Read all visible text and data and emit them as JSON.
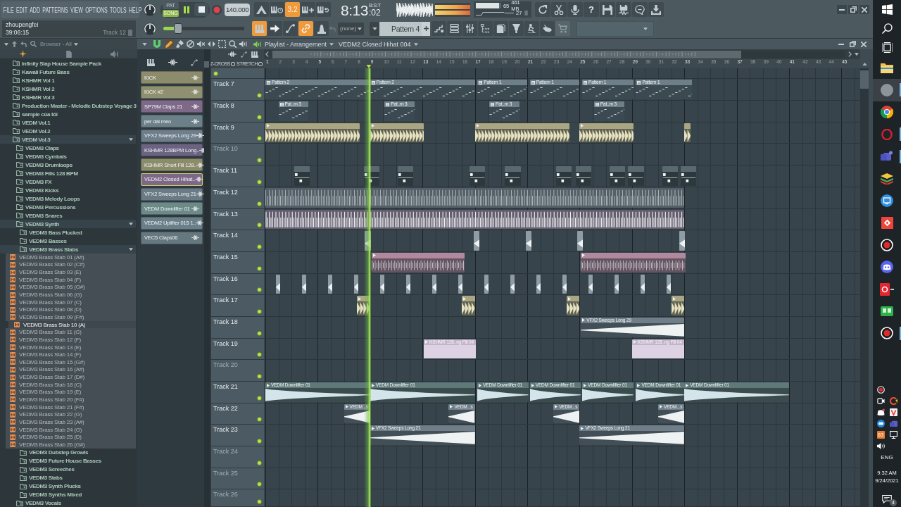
{
  "menu": [
    "FILE",
    "EDIT",
    "ADD",
    "PATTERNS",
    "VIEW",
    "OPTIONS",
    "TOOLS",
    "HELP"
  ],
  "transport": {
    "modes": [
      {
        "label": "PAT",
        "selected": false
      },
      {
        "label": "SONG",
        "selected": true
      }
    ],
    "playing": true,
    "tempo": "140.000"
  },
  "record_options": [
    {
      "on": false
    },
    {
      "on": false
    },
    {
      "label": "3.2",
      "on": true
    },
    {
      "on": false
    },
    {
      "on": false
    }
  ],
  "clock": {
    "time": "8:13",
    "ticks": ":02",
    "unit": "B:S:T"
  },
  "cpu": {
    "level": 0.93,
    "reading": "65",
    "memory": "461 MB",
    "polyphony": "27"
  },
  "help": "?",
  "hint": {
    "user": "zhoupengfei",
    "time": "39:06:15",
    "target": "Track 12"
  },
  "master": {
    "level": 0.18
  },
  "snap_tools": [
    {
      "on": true
    },
    {
      "on": false
    },
    {
      "on": false
    },
    {
      "on": true
    },
    {
      "on": false
    }
  ],
  "mixer_target": "(none)",
  "pattern": "Pattern 4",
  "browser": {
    "title": "Browser - All",
    "items": [
      {
        "kind": "folder",
        "name": "Infinity Slap House Sample Pack",
        "expanded": false
      },
      {
        "kind": "folder",
        "name": "Kawaii Future Bass",
        "expanded": false
      },
      {
        "kind": "folder",
        "name": "KSHMR Vol 1",
        "expanded": false
      },
      {
        "kind": "folder",
        "name": "KSHMR Vol 2",
        "expanded": false
      },
      {
        "kind": "folder",
        "name": "KSHMR Vol 3",
        "expanded": false
      },
      {
        "kind": "folder",
        "name": "Production Master - Melodic Dubstep Voyage 3",
        "expanded": false
      },
      {
        "kind": "folder",
        "name": "sample của tôi",
        "expanded": false
      },
      {
        "kind": "folder",
        "name": "VEDM Vol.1",
        "expanded": false
      },
      {
        "kind": "folder",
        "name": "VEDM Vol.2",
        "expanded": false
      },
      {
        "kind": "folder",
        "name": "VEDM Vol.3",
        "expanded": true,
        "children": [
          {
            "kind": "folder",
            "name": "VEDM3 Claps",
            "expanded": false
          },
          {
            "kind": "folder",
            "name": "VEDM3 Cymbals",
            "expanded": false
          },
          {
            "kind": "folder",
            "name": "VEDM3 Drumloops",
            "expanded": false
          },
          {
            "kind": "folder",
            "name": "VEDM3 Fills 128 BPM",
            "expanded": false
          },
          {
            "kind": "folder",
            "name": "VEDM3 FX",
            "expanded": false
          },
          {
            "kind": "folder",
            "name": "VEDM3 Kicks",
            "expanded": false
          },
          {
            "kind": "folder",
            "name": "VEDM3 Melody Loops",
            "expanded": false
          },
          {
            "kind": "folder",
            "name": "VEDM3 Percussions",
            "expanded": false
          },
          {
            "kind": "folder",
            "name": "VEDM3 Snares",
            "expanded": false
          },
          {
            "kind": "folder",
            "name": "VEDM3 Synth",
            "expanded": true,
            "children": [
              {
                "kind": "folder",
                "name": "VEDM3 Bass Plucked",
                "expanded": false
              },
              {
                "kind": "folder",
                "name": "VEDM3 Basses",
                "expanded": false
              },
              {
                "kind": "folder",
                "name": "VEDM3 Brass Stabs",
                "expanded": true,
                "children": [
                  {
                    "kind": "file",
                    "name": "VEDM3 Brass Stab 01 (A#)",
                    "selected": false
                  },
                  {
                    "kind": "file",
                    "name": "VEDM3 Brass Stab 02 (C#)",
                    "selected": false
                  },
                  {
                    "kind": "file",
                    "name": "VEDM3 Brass Stab 03 (E)",
                    "selected": false
                  },
                  {
                    "kind": "file",
                    "name": "VEDM3 Brass Stab 04 (F)",
                    "selected": false
                  },
                  {
                    "kind": "file",
                    "name": "VEDM3 Brass Stab 05 (G#)",
                    "selected": false
                  },
                  {
                    "kind": "file",
                    "name": "VEDM3 Brass Stab 06 (G)",
                    "selected": false
                  },
                  {
                    "kind": "file",
                    "name": "VEDM3 Brass Stab 07 (C)",
                    "selected": false
                  },
                  {
                    "kind": "file",
                    "name": "VEDM3 Brass Stab 08 (D)",
                    "selected": false
                  },
                  {
                    "kind": "file",
                    "name": "VEDM3 Brass Stab 09 (F#)",
                    "selected": false
                  },
                  {
                    "kind": "file",
                    "name": "VEDM3 Brass Stab 10 (A)",
                    "selected": true
                  },
                  {
                    "kind": "file",
                    "name": "VEDM3 Brass Stab 11 (G)",
                    "selected": false
                  },
                  {
                    "kind": "file",
                    "name": "VEDM3 Brass Stab 12 (F)",
                    "selected": false
                  },
                  {
                    "kind": "file",
                    "name": "VEDM3 Brass Stab 13 (E)",
                    "selected": false
                  },
                  {
                    "kind": "file",
                    "name": "VEDM3 Brass Stab 14 (F)",
                    "selected": false
                  },
                  {
                    "kind": "file",
                    "name": "VEDM3 Brass Stab 15 (G#)",
                    "selected": false
                  },
                  {
                    "kind": "file",
                    "name": "VEDM3 Brass Stab 16 (A#)",
                    "selected": false
                  },
                  {
                    "kind": "file",
                    "name": "VEDM3 Brass Stab 17 (D#)",
                    "selected": false
                  },
                  {
                    "kind": "file",
                    "name": "VEDM3 Brass Stab 18 (C)",
                    "selected": false
                  },
                  {
                    "kind": "file",
                    "name": "VEDM3 Brass Stab 19 (E)",
                    "selected": false
                  },
                  {
                    "kind": "file",
                    "name": "VEDM3 Brass Stab 20 (F#)",
                    "selected": false
                  },
                  {
                    "kind": "file",
                    "name": "VEDM3 Brass Stab 21 (F#)",
                    "selected": false
                  },
                  {
                    "kind": "file",
                    "name": "VEDM3 Brass Stab 22 (G)",
                    "selected": false
                  },
                  {
                    "kind": "file",
                    "name": "VEDM3 Brass Stab 23 (A#)",
                    "selected": false
                  },
                  {
                    "kind": "file",
                    "name": "VEDM3 Brass Stab 24 (G)",
                    "selected": false
                  },
                  {
                    "kind": "file",
                    "name": "VEDM3 Brass Stab 25 (D)",
                    "selected": false
                  },
                  {
                    "kind": "file",
                    "name": "VEDM3 Brass Stab 26 (G#)",
                    "selected": false
                  }
                ]
              },
              {
                "kind": "folder",
                "name": "VEDM3 Dubstep Growls",
                "expanded": false
              },
              {
                "kind": "folder",
                "name": "VEDM3 Future House Basses",
                "expanded": false
              },
              {
                "kind": "folder",
                "name": "VEDM3 Screeches",
                "expanded": false
              },
              {
                "kind": "folder",
                "name": "VEDM3 Stabs",
                "expanded": false
              },
              {
                "kind": "folder",
                "name": "VEDM3 Synth Plucks",
                "expanded": false
              },
              {
                "kind": "folder",
                "name": "VEDM3 Synths Mixed",
                "expanded": false
              }
            ]
          },
          {
            "kind": "folder",
            "name": "VEDM3 Vocals",
            "expanded": false
          }
        ]
      }
    ]
  },
  "playlist": {
    "title": "Playlist - Arrangement",
    "pattern": "VEDM2 Closed Hihat 004",
    "tools": [
      {
        "selected": true
      },
      {
        "selected": false
      },
      {
        "selected": false
      },
      {
        "selected": false
      },
      {
        "selected": false
      },
      {
        "selected": false
      },
      {
        "selected": false
      },
      {
        "selected": false
      }
    ],
    "channels": [
      {
        "name": "KICK",
        "color": "#8c8c6c",
        "selected": false
      },
      {
        "name": "KICK #2",
        "color": "#8f906f",
        "selected": false
      },
      {
        "name": "SP79M Claps 21",
        "color": "#7e6a88",
        "selected": false
      },
      {
        "name": "per dai meo",
        "color": "#6c808a",
        "selected": false
      },
      {
        "name": "VFX2 Sweeps Long 29",
        "color": "#6e7e8a",
        "selected": false
      },
      {
        "name": "KSHMR 128BPM Long..",
        "color": "#6b6380",
        "selected": false
      },
      {
        "name": "KSHMR Short Fill 128..",
        "color": "#8b8c6a",
        "selected": false
      },
      {
        "name": "VEDM2 Closed Hihat..",
        "color": "#7e6888",
        "selected": true
      },
      {
        "name": "VFX2 Sweeps Long 21",
        "color": "#6a7b86",
        "selected": false
      },
      {
        "name": "VEDM Downlifter 01",
        "color": "#6b8a88",
        "selected": false
      },
      {
        "name": "VEDM2 Uplifter 015 1..",
        "color": "#6b7f8a",
        "selected": false
      },
      {
        "name": "VEC5 Claps06",
        "color": "#66787f",
        "selected": false
      }
    ],
    "options": [
      {
        "label": "Z-CROSS",
        "checked": false
      },
      {
        "label": "STRETCH",
        "checked": false
      }
    ],
    "bars": [
      "1",
      "2",
      "3",
      "4",
      "5",
      "6",
      "7",
      "8",
      "9",
      "10",
      "11",
      "12",
      "13",
      "14",
      "15",
      "16",
      "17",
      "18",
      "19",
      "20",
      "21",
      "22",
      "23",
      "24",
      "25",
      "26",
      "27",
      "28",
      "29",
      "30",
      "31",
      "32",
      "33",
      "34",
      "35",
      "36",
      "37",
      "38",
      "39",
      "40",
      "41",
      "42",
      "43",
      "44",
      "45"
    ],
    "playhead": {
      "level": 0.177
    },
    "tracks": [
      {
        "on": true
      },
      {
        "name": "Track 7",
        "on": true,
        "dimmed": false,
        "color": "#6e7f89",
        "clips": [
          {
            "kind": "pattern",
            "name": "Pattern 2"
          },
          {
            "kind": "pattern",
            "name": "Pattern 2"
          },
          {
            "kind": "pattern",
            "name": "Pattern 1"
          },
          {
            "kind": "pattern",
            "name": "Pattern 1"
          },
          {
            "kind": "pattern",
            "name": "Pattern 1"
          },
          {
            "kind": "pattern",
            "name": "Pattern 1"
          }
        ]
      },
      {
        "name": "Track 8",
        "on": true,
        "dimmed": false,
        "color": "#6e7f89",
        "clips": [
          {
            "kind": "pattern",
            "name": "Pat..rn 3"
          },
          {
            "kind": "pattern",
            "name": "Pat..rn 3"
          },
          {
            "kind": "pattern",
            "name": "Pat..rn 3"
          },
          {
            "kind": "pattern",
            "name": "Pat..rn 3"
          }
        ]
      },
      {
        "name": "Track 9",
        "on": true,
        "dimmed": false,
        "color": "#aaa683",
        "clips": [
          {
            "kind": "audio"
          },
          {
            "kind": "audio"
          },
          {
            "kind": "audio"
          },
          {
            "kind": "audio"
          },
          {
            "kind": "audio"
          }
        ]
      },
      {
        "name": "Track 10",
        "on": true,
        "dimmed": true
      },
      {
        "name": "Track 11",
        "on": true,
        "dimmed": false,
        "color": "#5a6870",
        "clips": [
          {
            "kind": "steps"
          },
          {
            "kind": "steps"
          },
          {
            "kind": "steps"
          },
          {
            "kind": "steps"
          },
          {
            "kind": "steps"
          },
          {
            "kind": "steps"
          },
          {
            "kind": "steps"
          },
          {
            "kind": "steps"
          },
          {
            "kind": "steps"
          },
          {
            "kind": "steps"
          },
          {
            "kind": "steps"
          }
        ]
      },
      {
        "name": "Track 12",
        "on": true,
        "dimmed": false,
        "color": "#76828b",
        "clips": [
          {
            "kind": "hits"
          }
        ]
      },
      {
        "name": "Track 13",
        "on": true,
        "dimmed": false,
        "color": "#8e7e95",
        "clips": [
          {
            "kind": "hits"
          }
        ]
      },
      {
        "name": "Track 14",
        "on": true,
        "dimmed": false,
        "color": "#8f9ca4",
        "clips": [
          {
            "kind": "audio"
          },
          {
            "kind": "audio"
          },
          {
            "kind": "audio"
          },
          {
            "kind": "audio"
          },
          {
            "kind": "audio"
          }
        ]
      },
      {
        "name": "Track 15",
        "on": true,
        "dimmed": false,
        "color": "#b1899e",
        "clips": [
          {
            "kind": "audio"
          },
          {
            "kind": "audio"
          }
        ]
      },
      {
        "name": "Track 16",
        "on": true,
        "dimmed": false,
        "color": "#8f9ca4",
        "clips": [
          {
            "kind": "audio"
          },
          {
            "kind": "audio"
          },
          {
            "kind": "audio"
          },
          {
            "kind": "audio"
          },
          {
            "kind": "audio"
          },
          {
            "kind": "audio"
          },
          {
            "kind": "audio"
          },
          {
            "kind": "audio"
          },
          {
            "kind": "audio"
          },
          {
            "kind": "audio"
          },
          {
            "kind": "audio"
          },
          {
            "kind": "audio"
          },
          {
            "kind": "audio"
          },
          {
            "kind": "audio"
          },
          {
            "kind": "audio"
          },
          {
            "kind": "audio"
          }
        ]
      },
      {
        "name": "Track 17",
        "on": true,
        "dimmed": false,
        "color": "#a9a783",
        "clips": [
          {
            "kind": "audio"
          },
          {
            "kind": "audio"
          },
          {
            "kind": "audio"
          },
          {
            "kind": "audio"
          }
        ]
      },
      {
        "name": "Track 18",
        "on": true,
        "dimmed": false,
        "color": "#6f7e88",
        "clips": [
          {
            "kind": "audio",
            "name": "VFX2 Sweeps Long 29"
          }
        ]
      },
      {
        "name": "Track 19",
        "on": true,
        "dimmed": false,
        "color": "#c4b4cb",
        "clips": [
          {
            "kind": "audio",
            "name": "KSHMR 128..ng Fill 04"
          },
          {
            "kind": "audio",
            "name": "KSHMR 128..ng Fill 04"
          }
        ]
      },
      {
        "name": "Track 20",
        "on": true,
        "dimmed": true
      },
      {
        "name": "Track 21",
        "on": true,
        "dimmed": false,
        "color": "#5f7878",
        "clips": [
          {
            "kind": "audio",
            "name": "VEDM Downlifter 01"
          },
          {
            "kind": "audio",
            "name": "VEDM Downlifter 01"
          },
          {
            "kind": "audio",
            "name": "VEDM Downlifter 01"
          },
          {
            "kind": "audio",
            "name": "VEDM Downlifter 01"
          },
          {
            "kind": "audio",
            "name": "VEDM Downlifter 01"
          },
          {
            "kind": "audio",
            "name": "VEDM Downlifter 01"
          },
          {
            "kind": "audio",
            "name": "VEDM Downlifter 01"
          }
        ]
      },
      {
        "name": "Track 22",
        "on": true,
        "dimmed": false,
        "color": "#6f7e88",
        "clips": [
          {
            "kind": "audio",
            "name": "VEDM...s"
          },
          {
            "kind": "audio",
            "name": "VEDM...s"
          },
          {
            "kind": "audio",
            "name": "VEDM...s"
          },
          {
            "kind": "audio",
            "name": "VEDM...s"
          }
        ]
      },
      {
        "name": "Track 23",
        "on": true,
        "dimmed": false,
        "color": "#6f7e88",
        "clips": [
          {
            "kind": "audio",
            "name": "VFX2 Sweeps Long 21"
          },
          {
            "kind": "audio",
            "name": "VFX2 Sweeps Long 21"
          }
        ]
      },
      {
        "name": "Track 24",
        "on": true,
        "dimmed": true
      },
      {
        "name": "Track 25",
        "on": true,
        "dimmed": true
      },
      {
        "name": "Track 26",
        "on": true,
        "dimmed": true
      }
    ]
  },
  "taskbar": {
    "apps": [
      {
        "selected": false,
        "running": false
      },
      {
        "selected": true,
        "running": true
      },
      {
        "selected": false,
        "running": false
      },
      {
        "selected": false,
        "running": true
      },
      {
        "selected": false,
        "running": true
      },
      {
        "selected": false,
        "running": false
      },
      {
        "selected": false,
        "running": false
      },
      {
        "selected": false,
        "running": false
      },
      {
        "selected": false,
        "running": false
      },
      {
        "selected": false,
        "running": false
      },
      {
        "selected": false,
        "running": false
      },
      {
        "selected": false,
        "running": false
      },
      {
        "selected": false,
        "running": true
      }
    ],
    "tray_counter": "63",
    "language": "ENG",
    "time": "9:32 AM",
    "date": "9/24/2021",
    "notifications": "4"
  }
}
